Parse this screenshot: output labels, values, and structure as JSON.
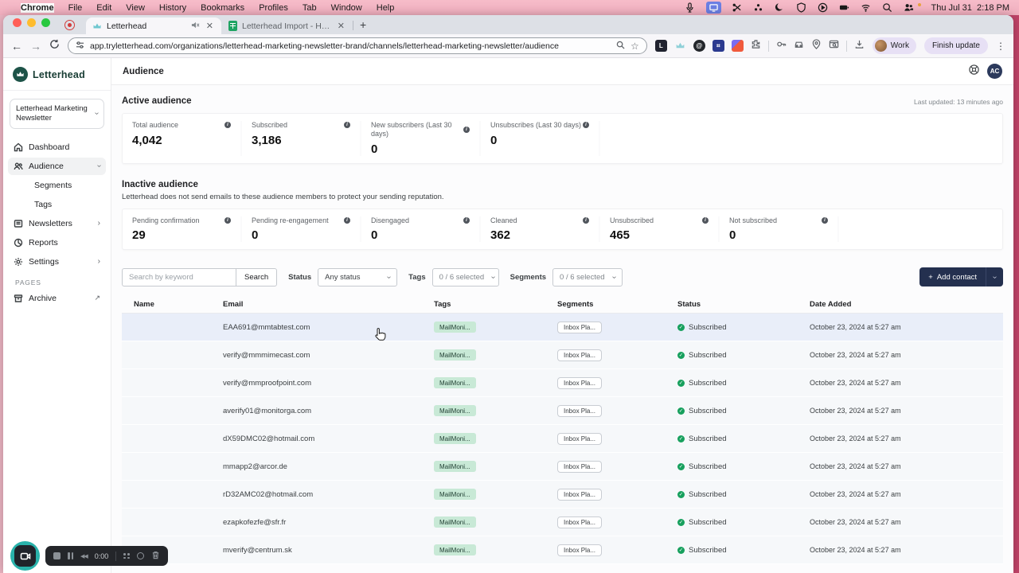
{
  "menu_bar": {
    "items": [
      "Chrome",
      "File",
      "Edit",
      "View",
      "History",
      "Bookmarks",
      "Profiles",
      "Tab",
      "Window",
      "Help"
    ],
    "date": "Thu Jul 31",
    "time": "2:18 PM"
  },
  "browser": {
    "tab1_title": "Letterhead",
    "tab2_title": "Letterhead Import - How To",
    "url": "app.tryletterhead.com/organizations/letterhead-marketing-newsletter-brand/channels/letterhead-marketing-newsletter/audience",
    "profile_label": "Work",
    "update_label": "Finish update"
  },
  "app": {
    "brand": "Letterhead",
    "newsletter_selector": "Letterhead Marketing Newsletter",
    "sidebar_items": [
      "Dashboard",
      "Audience",
      "Segments",
      "Tags",
      "Newsletters",
      "Reports",
      "Settings"
    ],
    "pages_label": "PAGES",
    "archive_label": "Archive",
    "header_title": "Audience",
    "avatar_initials": "AC"
  },
  "active_audience": {
    "title": "Active audience",
    "last_updated": "Last updated: 13 minutes ago",
    "stats": [
      {
        "label": "Total audience",
        "value": "4,042"
      },
      {
        "label": "Subscribed",
        "value": "3,186"
      },
      {
        "label": "New subscribers (Last 30 days)",
        "value": "0"
      },
      {
        "label": "Unsubscribes (Last 30 days)",
        "value": "0"
      }
    ]
  },
  "inactive_audience": {
    "title": "Inactive audience",
    "description": "Letterhead does not send emails to these audience members to protect your sending reputation.",
    "stats": [
      {
        "label": "Pending confirmation",
        "value": "29"
      },
      {
        "label": "Pending re-engagement",
        "value": "0"
      },
      {
        "label": "Disengaged",
        "value": "0"
      },
      {
        "label": "Cleaned",
        "value": "362"
      },
      {
        "label": "Unsubscribed",
        "value": "465"
      },
      {
        "label": "Not subscribed",
        "value": "0"
      }
    ]
  },
  "filters": {
    "search_placeholder": "Search by keyword",
    "search_button": "Search",
    "status_label": "Status",
    "status_value": "Any status",
    "tags_label": "Tags",
    "tags_value": "0 / 6 selected",
    "segments_label": "Segments",
    "segments_value": "0 / 6 selected",
    "add_contact_label": "Add contact"
  },
  "table": {
    "columns": [
      "Name",
      "Email",
      "Tags",
      "Segments",
      "Status",
      "Date Added"
    ],
    "tag_chip": "MailMoni...",
    "segment_chip": "Inbox Pla...",
    "rows": [
      {
        "name": "",
        "email": "EAA691@mmtabtest.com",
        "status": "Subscribed",
        "date": "October 23, 2024 at 5:27 am"
      },
      {
        "name": "",
        "email": "verify@mmmimecast.com",
        "status": "Subscribed",
        "date": "October 23, 2024 at 5:27 am"
      },
      {
        "name": "",
        "email": "verify@mmproofpoint.com",
        "status": "Subscribed",
        "date": "October 23, 2024 at 5:27 am"
      },
      {
        "name": "",
        "email": "averify01@monitorga.com",
        "status": "Subscribed",
        "date": "October 23, 2024 at 5:27 am"
      },
      {
        "name": "",
        "email": "dX59DMC02@hotmail.com",
        "status": "Subscribed",
        "date": "October 23, 2024 at 5:27 am"
      },
      {
        "name": "",
        "email": "mmapp2@arcor.de",
        "status": "Subscribed",
        "date": "October 23, 2024 at 5:27 am"
      },
      {
        "name": "",
        "email": "rD32AMC02@hotmail.com",
        "status": "Subscribed",
        "date": "October 23, 2024 at 5:27 am"
      },
      {
        "name": "",
        "email": "ezapkofezfe@sfr.fr",
        "status": "Subscribed",
        "date": "October 23, 2024 at 5:27 am"
      },
      {
        "name": "",
        "email": "mverify@centrum.sk",
        "status": "Subscribed",
        "date": "October 23, 2024 at 5:27 am"
      }
    ]
  },
  "recorder": {
    "timer": "0:00"
  },
  "colors": {
    "brand_green": "#1d5348",
    "navy_button": "#24304f",
    "tag_mint": "#c8e9d6",
    "success_green": "#17a05d",
    "menubar_pink": "#f3b6c4"
  }
}
